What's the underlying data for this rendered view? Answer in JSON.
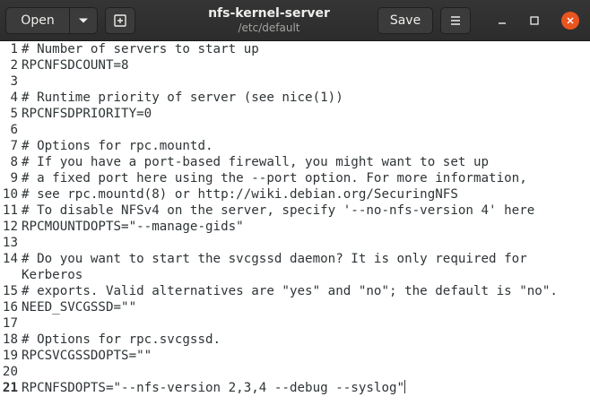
{
  "header": {
    "open_label": "Open",
    "save_label": "Save",
    "title": "nfs-kernel-server",
    "subtitle": "/etc/default"
  },
  "editor": {
    "cursor_line": 21,
    "lines": [
      {
        "n": "1",
        "text": "# Number of servers to start up"
      },
      {
        "n": "2",
        "text": "RPCNFSDCOUNT=8"
      },
      {
        "n": "3",
        "text": ""
      },
      {
        "n": "4",
        "text": "# Runtime priority of server (see nice(1))"
      },
      {
        "n": "5",
        "text": "RPCNFSDPRIORITY=0"
      },
      {
        "n": "6",
        "text": ""
      },
      {
        "n": "7",
        "text": "# Options for rpc.mountd."
      },
      {
        "n": "8",
        "text": "# If you have a port-based firewall, you might want to set up"
      },
      {
        "n": "9",
        "text": "# a fixed port here using the --port option. For more information,"
      },
      {
        "n": "10",
        "text": "# see rpc.mountd(8) or http://wiki.debian.org/SecuringNFS"
      },
      {
        "n": "11",
        "text": "# To disable NFSv4 on the server, specify '--no-nfs-version 4' here"
      },
      {
        "n": "12",
        "text": "RPCMOUNTDOPTS=\"--manage-gids\""
      },
      {
        "n": "13",
        "text": ""
      },
      {
        "n": "14",
        "text": "# Do you want to start the svcgssd daemon? It is only required for",
        "wrap": "Kerberos"
      },
      {
        "n": "15",
        "text": "# exports. Valid alternatives are \"yes\" and \"no\"; the default is \"no\"."
      },
      {
        "n": "16",
        "text": "NEED_SVCGSSD=\"\""
      },
      {
        "n": "17",
        "text": ""
      },
      {
        "n": "18",
        "text": "# Options for rpc.svcgssd."
      },
      {
        "n": "19",
        "text": "RPCSVCGSSDOPTS=\"\""
      },
      {
        "n": "20",
        "text": ""
      },
      {
        "n": "21",
        "text": "RPCNFSDOPTS=\"--nfs-version 2,3,4 --debug --syslog\""
      }
    ]
  },
  "icons": {
    "open_menu": "chevron-down-icon",
    "new_tab": "new-tab-icon",
    "menu": "hamburger-menu-icon",
    "minimize": "minimize-icon",
    "maximize": "maximize-icon",
    "close": "close-icon"
  },
  "colors": {
    "headerbar": "#2c2c2c",
    "close_button": "#e9541f",
    "text": "#2e3436"
  }
}
